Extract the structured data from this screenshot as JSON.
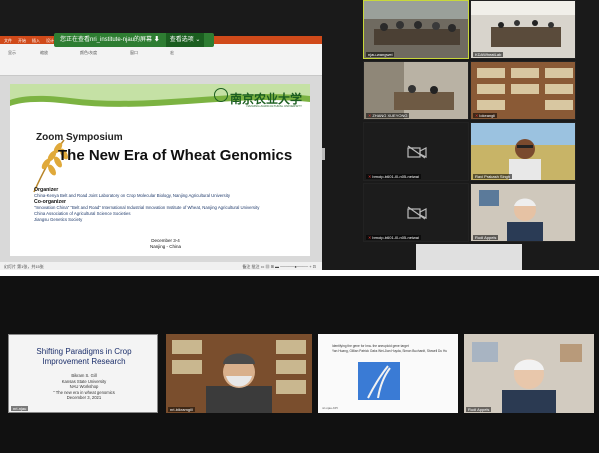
{
  "share": {
    "banner_text": "您正在查看nri_institute-njau的屏幕 ⬇",
    "banner_option": "查看选项 ⌄",
    "ribbon_tabs": [
      "文件",
      "开始",
      "插入",
      "设计",
      "切换",
      "动画",
      "幻灯片放映",
      "审阅",
      "视图",
      "帮助",
      "告诉我你想要做什么"
    ],
    "ribbon_groups": [
      "显示",
      "缩放",
      "颜色/灰度",
      "窗口",
      "宏"
    ],
    "statusbar_left": "幻灯片 第1张，共15张",
    "statusbar_right": "备注   批注   ▭  ▦  ⊞  ▬  ─────●──── +  ⊡"
  },
  "slide": {
    "logo_text": "南京农业大学",
    "logo_sub": "NANJING AGRICULTURAL UNIVERSITY",
    "symposium": "Zoom Symposium",
    "title": "The New Era of Wheat Genomics",
    "organizer_label": "Organizer",
    "organizer": "China-Kenya Belt and Road Joint Laboratory on Crop Molecular Biology, Nanjing Agricultural University",
    "coorganizer_label": "Co-organizer",
    "coorganizers": [
      "\"Innovation China\" \"Belt and Road\" International Industrial Innovation Institute of Wheat, Nanjing Agricultural University",
      "China Association of Agricultural Science Societies",
      "Jiangsu Genetics Society"
    ],
    "date": "December 3-4",
    "location": "Nanjing - China"
  },
  "participants": [
    {
      "name": "njau-wangwei",
      "muted": false,
      "scene": "meeting-room"
    },
    {
      "name": "KDAWheatLab",
      "muted": false,
      "scene": "conference"
    },
    {
      "name": "ZHANG XUEYONG",
      "muted": true,
      "scene": "office"
    },
    {
      "name": "lokeangli",
      "muted": true,
      "scene": "bookshelf"
    },
    {
      "name": "brnoip-b601-l0-n05-neiwai",
      "muted": true,
      "scene": "camera-off"
    },
    {
      "name": "Ravi Prakash Singh",
      "muted": false,
      "scene": "field-person"
    },
    {
      "name": "brnoip-b601-l0-n05-neiwai",
      "muted": true,
      "scene": "camera-off"
    },
    {
      "name": "Rudi Appels",
      "muted": false,
      "scene": "person-white-hair"
    }
  ],
  "bottom": {
    "slide_title": "Shifting Paradigms in Crop Improvement Research",
    "slide_lines": [
      "Bikram S. Gill",
      "Kansas State University",
      "NAU Workshop",
      "\" The new era in wheat genomics",
      "December 3, 2021"
    ],
    "slide_name": "nri-njau",
    "speaker_name": "nri-bikramgill",
    "doc_heading": "Identifying the gene for Ima- the aneuploid gene target",
    "doc_sub": "Yan Huang, Gillian Patrick Oaks Wei-Jian Huyda, Simon Buchardt, Stowell Du Hu",
    "doc_footer": "nri-njau-KPI",
    "person_name": "Rudi Appels"
  },
  "colors": {
    "accent": "#c8d83a",
    "banner": "#2e7d32",
    "muted": "#e53935"
  }
}
